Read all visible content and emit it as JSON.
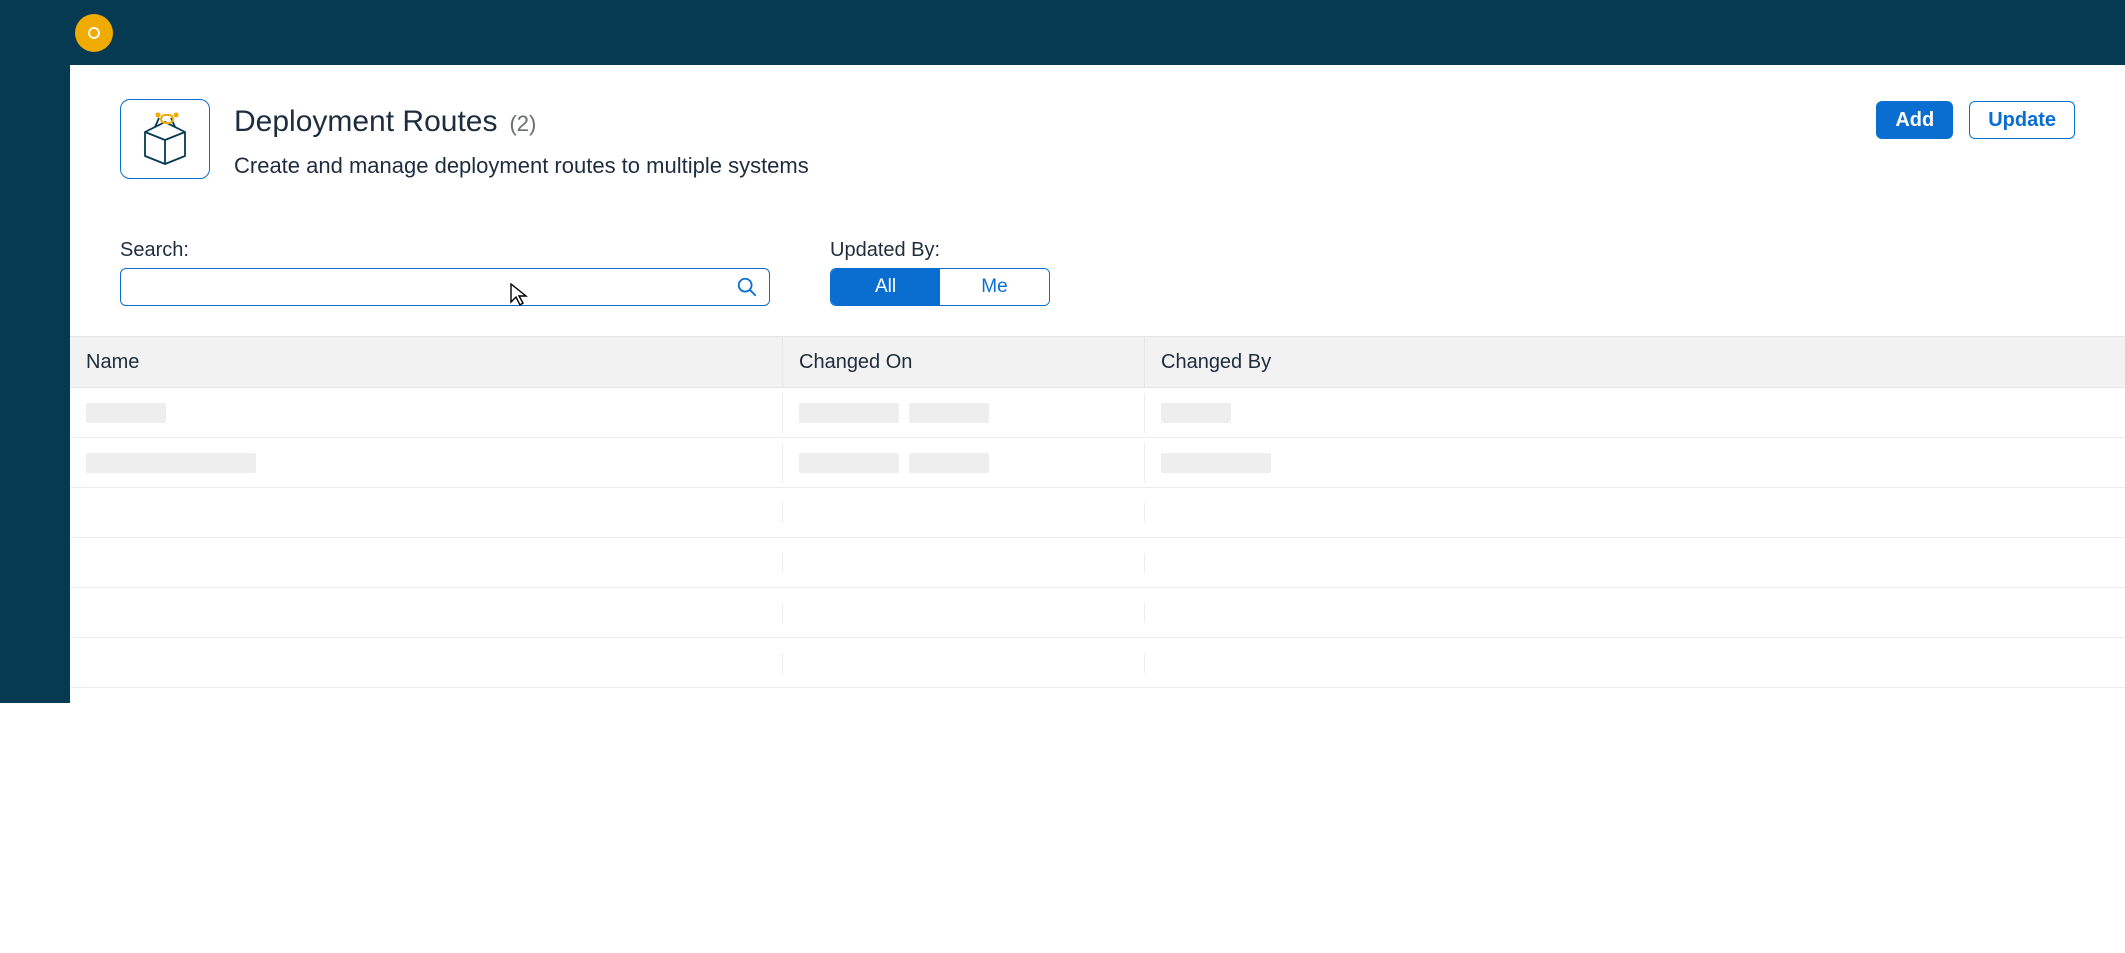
{
  "header": {
    "title": "Deployment Routes",
    "count": "(2)",
    "subtitle": "Create and manage deployment routes to multiple systems",
    "add_label": "Add",
    "update_label": "Update"
  },
  "filters": {
    "search_label": "Search:",
    "search_value": "",
    "updated_by_label": "Updated By:",
    "toggle": {
      "all": "All",
      "me": "Me",
      "active": "all"
    }
  },
  "table": {
    "columns": {
      "name": "Name",
      "changed_on": "Changed On",
      "changed_by": "Changed By"
    }
  }
}
